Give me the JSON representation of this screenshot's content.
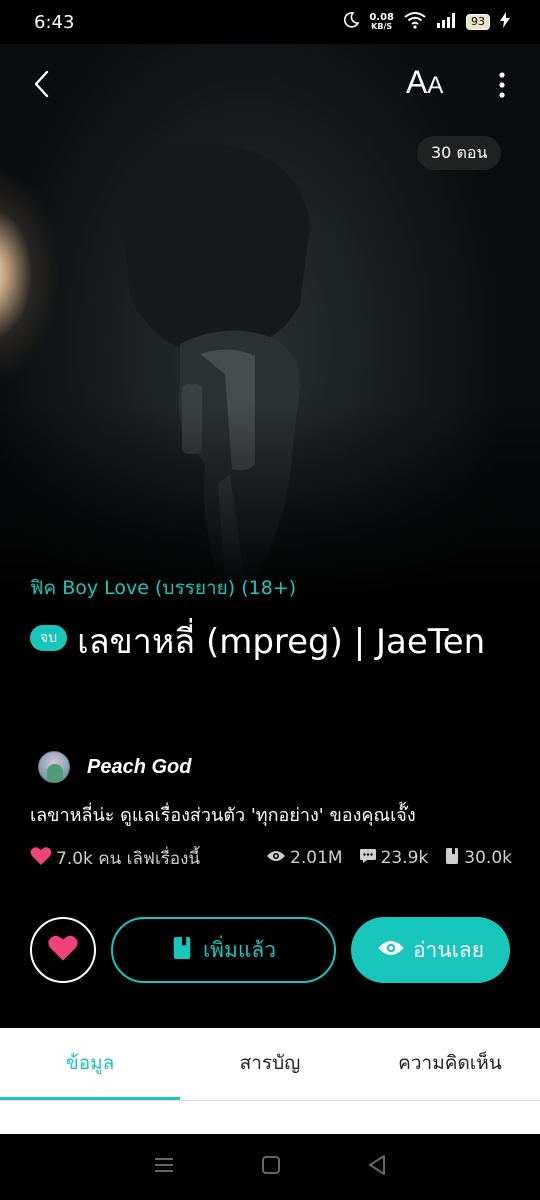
{
  "status_bar": {
    "time": "6:43",
    "net_speed_value": "0.08",
    "net_speed_unit": "KB/S",
    "battery": "93"
  },
  "header": {
    "font_size_big": "A",
    "font_size_small": "A",
    "episode_count": "30 ตอน"
  },
  "story": {
    "category": "ฟิค Boy Love (บรรยาย)  (18+)",
    "status_label": "จบ",
    "title": "เลขาหลี่  (mpreg) | JaeTen",
    "author": "Peach God",
    "description": "เลขาหลี่น่ะ ดูแลเรื่องส่วนตัว 'ทุกอย่าง' ของคุณเจ๊้ง"
  },
  "stats": {
    "likes": "7.0k คน เลิฟเรื่องนี้",
    "views": "2.01M",
    "comments": "23.9k",
    "chapters_read": "30.0k"
  },
  "actions": {
    "library_label": "เพิ่มแล้ว",
    "read_label": "อ่านเลย"
  },
  "tabs": [
    {
      "label": "ข้อมูล",
      "active": true
    },
    {
      "label": "สารบัญ",
      "active": false
    },
    {
      "label": "ความคิดเห็น",
      "active": false
    }
  ],
  "colors": {
    "accent": "#19c6bc",
    "heart": "#f0427a"
  },
  "icons": [
    "moon-icon",
    "wifi-icon",
    "signal-icon",
    "battery-icon",
    "charging-icon",
    "back-icon",
    "font-size-icon",
    "more-icon",
    "heart-icon",
    "eye-icon",
    "comment-icon",
    "book-icon",
    "menu-icon",
    "home-icon",
    "back-nav-icon"
  ]
}
